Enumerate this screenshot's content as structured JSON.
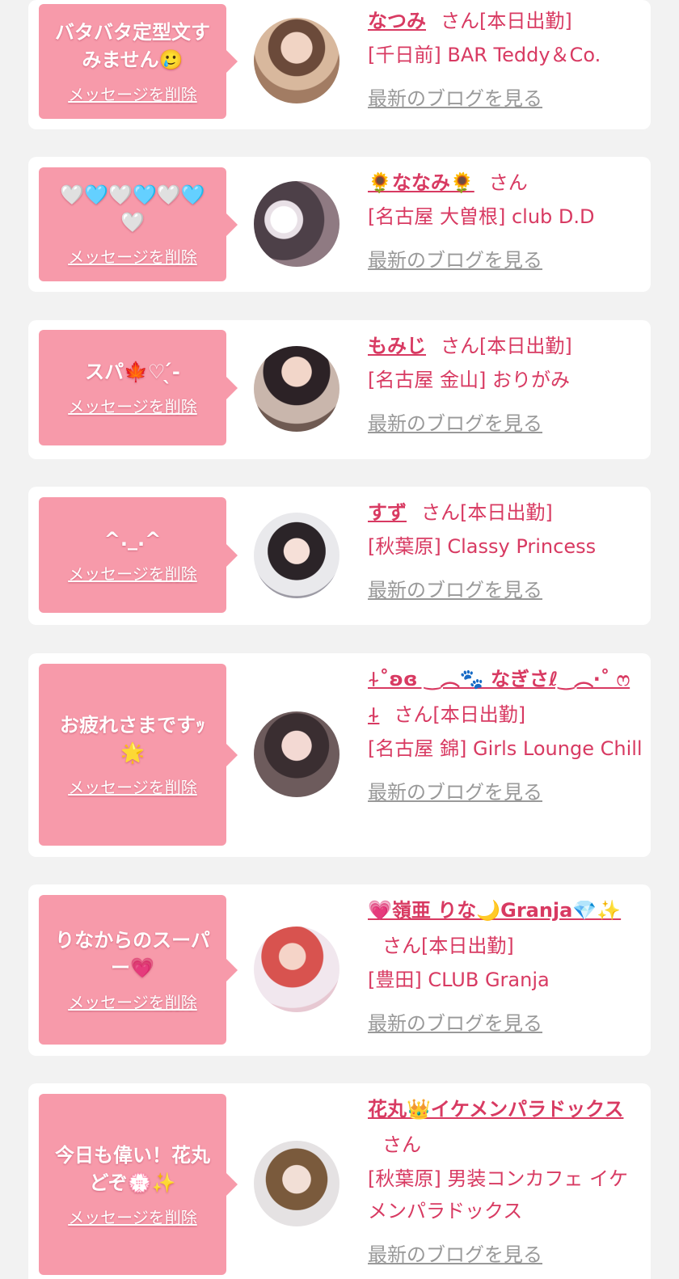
{
  "common": {
    "delete_label": "メッセージを削除",
    "san": "さん",
    "blog_label": "最新のブログを見る"
  },
  "cards": [
    {
      "message": "バタバタ定型文すみません🥲",
      "name": "なつみ",
      "status": "[本日出勤]",
      "shop": "[千日前] BAR Teddy＆Co."
    },
    {
      "message": "🤍🩵🤍🩵🤍🩵🤍",
      "name": "🌻ななみ🌻",
      "status": "",
      "shop": "[名古屋 大曽根] club D.D"
    },
    {
      "message": "スパ🍁♡ ̖́-",
      "name": "もみじ",
      "status": "[本日出勤]",
      "shop": "[名古屋 金山] おりがみ"
    },
    {
      "message": "^._.^",
      "name": "すず",
      "status": "[本日出勤]",
      "shop": "[秋葉原] Classy Princess"
    },
    {
      "message": "お疲れさまですｯ🌟",
      "name": "⍭˚ʚ︎ɞ ‿︵🐾 なぎさℓ‿︵‧˚ ෆ ⍭",
      "status": "[本日出勤]",
      "shop": "[名古屋 錦] Girls Lounge Chill"
    },
    {
      "message": "りなからのスーパー💗",
      "name": "💗嶺亜 りな🌙Granja💎✨",
      "status": "[本日出勤]",
      "shop": "[豊田] CLUB Granja"
    },
    {
      "message": "今日も偉い！花丸どぞ💮✨",
      "name": "花丸👑イケメンパラドックス",
      "status": "",
      "shop": "[秋葉原] 男装コンカフェ イケメンパラドックス"
    }
  ]
}
